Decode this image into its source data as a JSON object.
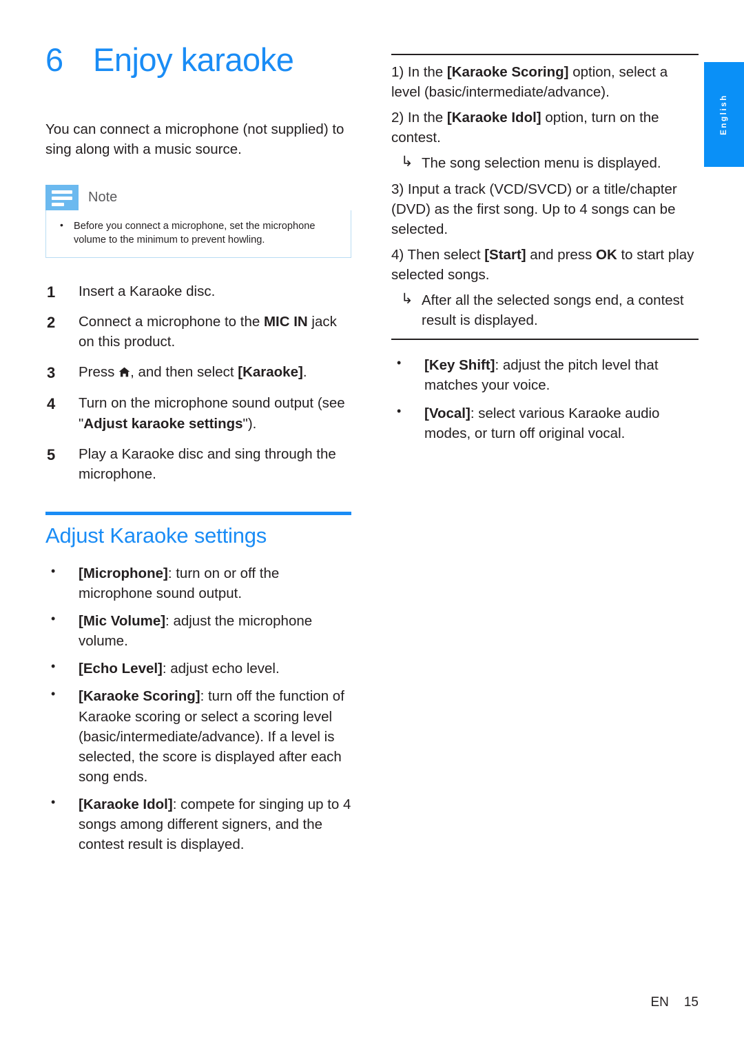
{
  "language_tab": {
    "label": "English"
  },
  "chapter": {
    "number": "6",
    "title": "Enjoy karaoke"
  },
  "intro": "You can connect a microphone (not supplied) to sing along with a music source.",
  "note": {
    "title": "Note",
    "icon": "note-lines-icon",
    "items": [
      "Before you connect a microphone, set the microphone volume to the minimum to prevent howling."
    ]
  },
  "steps": [
    {
      "text_before": "Insert a Karaoke disc.",
      "bold": "",
      "text_after": ""
    },
    {
      "text_before": "Connect a microphone to the ",
      "bold": "MIC IN",
      "text_after": " jack on this product."
    },
    {
      "text_before": "Press ",
      "icon": "home-icon",
      "bold": "[Karaoke]",
      "text_middle": ", and then select ",
      "text_after": "."
    },
    {
      "text_before": "Turn on the microphone sound output (see \"",
      "bold": "Adjust karaoke settings",
      "text_after": "\")."
    },
    {
      "text_before": "Play a Karaoke disc and sing through the microphone.",
      "bold": "",
      "text_after": ""
    }
  ],
  "section": {
    "title": "Adjust Karaoke settings",
    "bullets": [
      {
        "term": "[Microphone]",
        "desc": ": turn on or off the microphone sound output."
      },
      {
        "term": "[Mic Volume]",
        "desc": ": adjust the microphone volume."
      },
      {
        "term": "[Echo Level]",
        "desc": ": adjust echo level."
      },
      {
        "term": "[Karaoke Scoring]",
        "desc": ": turn off the function of Karaoke scoring or select a scoring level (basic/intermediate/advance). If a level is selected, the score is displayed after each song ends."
      },
      {
        "term": "[Karaoke Idol]",
        "desc": ": compete for singing up to 4 songs among different signers, and the contest result is displayed."
      }
    ]
  },
  "procedure": {
    "step1": {
      "prefix": "1) In the ",
      "bold": "[Karaoke Scoring]",
      "suffix": " option, select a level (basic/intermediate/advance)."
    },
    "step2": {
      "prefix": "2) In the ",
      "bold": "[Karaoke Idol]",
      "suffix": " option, turn on the contest."
    },
    "result1": "The song selection menu is displayed.",
    "step3": {
      "prefix": "3) Input a track (VCD/SVCD) or a title/chapter (DVD) as the first song. Up to 4 songs can be selected.",
      "bold": "",
      "suffix": ""
    },
    "step4": {
      "prefix": "4) Then select ",
      "bold": "[Start]",
      "mid": " and press ",
      "bold2": "OK",
      "suffix": " to start play selected songs."
    },
    "result2": "After all the selected songs end, a contest result is displayed."
  },
  "bullets_right": [
    {
      "term": "[Key Shift]",
      "desc": ": adjust the pitch level that matches your voice."
    },
    {
      "term": "[Vocal]",
      "desc": ": select various Karaoke audio modes, or turn off original vocal."
    }
  ],
  "footer": {
    "lang_code": "EN",
    "page_number": "15"
  },
  "colors": {
    "accent_blue": "#1a8cf5",
    "tab_blue": "#0a90f7",
    "note_icon_blue": "#6bb9ef",
    "note_border": "#b9dcf3",
    "text": "#231f20"
  }
}
